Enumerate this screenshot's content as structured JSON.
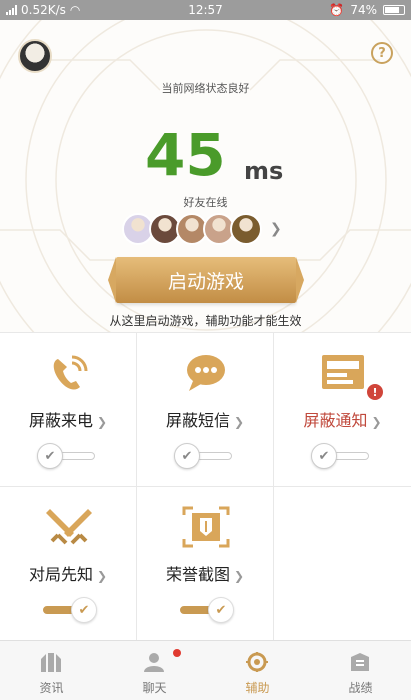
{
  "status_bar": {
    "net_speed": "0.52K/s",
    "time": "12:57",
    "battery": "74%"
  },
  "header": {
    "network_status": "当前网络状态良好",
    "ping_value": "45",
    "ping_unit": "ms",
    "friends_label": "好友在线"
  },
  "friends_avatar_colors": [
    "#d9d2e8",
    "#6b4a3c",
    "#b48866",
    "#c9a28a",
    "#7a5c2e"
  ],
  "start_button": {
    "label": "启动游戏"
  },
  "hint": "从这里启动游戏，辅助功能才能生效",
  "features": [
    {
      "label": "屏蔽来电",
      "icon": "phone-icon",
      "enabled": false,
      "alert": false
    },
    {
      "label": "屏蔽短信",
      "icon": "message-icon",
      "enabled": false,
      "alert": false
    },
    {
      "label": "屏蔽通知",
      "icon": "notification-icon",
      "enabled": false,
      "alert": true,
      "badge": "!"
    },
    {
      "label": "对局先知",
      "icon": "crossed-swords-icon",
      "enabled": true,
      "alert": false
    },
    {
      "label": "荣誉截图",
      "icon": "screenshot-icon",
      "enabled": true,
      "alert": false
    }
  ],
  "tabs": [
    {
      "label": "资讯",
      "icon": "news-icon",
      "active": false
    },
    {
      "label": "聊天",
      "icon": "chat-icon",
      "active": false,
      "dot": true
    },
    {
      "label": "辅助",
      "icon": "assist-icon",
      "active": true
    },
    {
      "label": "战绩",
      "icon": "record-icon",
      "active": false
    }
  ],
  "colors": {
    "accent": "#c99a52",
    "ping_green": "#4a9b2a",
    "alert_red": "#c0493c",
    "tab_dot": "#e03a30"
  }
}
